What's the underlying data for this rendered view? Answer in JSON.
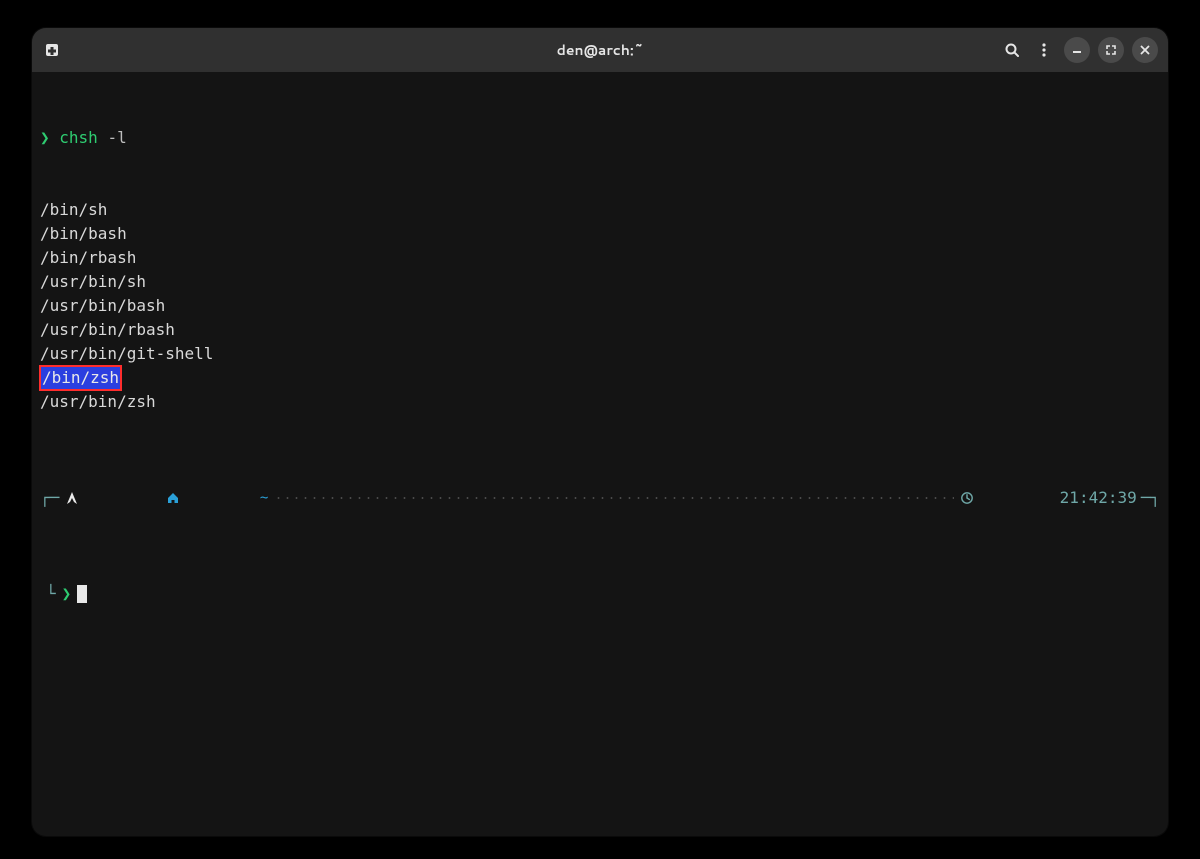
{
  "window": {
    "title": "den@arch:~"
  },
  "terminal": {
    "prompt_symbol": "❯",
    "command": {
      "name": "chsh",
      "args": "-l"
    },
    "output_lines": [
      "/bin/sh",
      "/bin/bash",
      "/bin/rbash",
      "/usr/bin/sh",
      "/usr/bin/bash",
      "/usr/bin/rbash",
      "/usr/bin/git-shell",
      "/bin/zsh",
      "/usr/bin/zsh"
    ],
    "highlighted_line_index": 7,
    "status": {
      "path_symbol": "~",
      "time": "21:42:39"
    },
    "next_prompt_symbol": "❯"
  },
  "icons": {
    "new_tab": "new-tab-icon",
    "search": "search-icon",
    "menu": "menu-icon",
    "minimize": "minimize-icon",
    "maximize": "maximize-icon",
    "close": "close-icon",
    "arch": "arch-logo-icon",
    "home": "home-icon",
    "clock": "clock-icon"
  }
}
